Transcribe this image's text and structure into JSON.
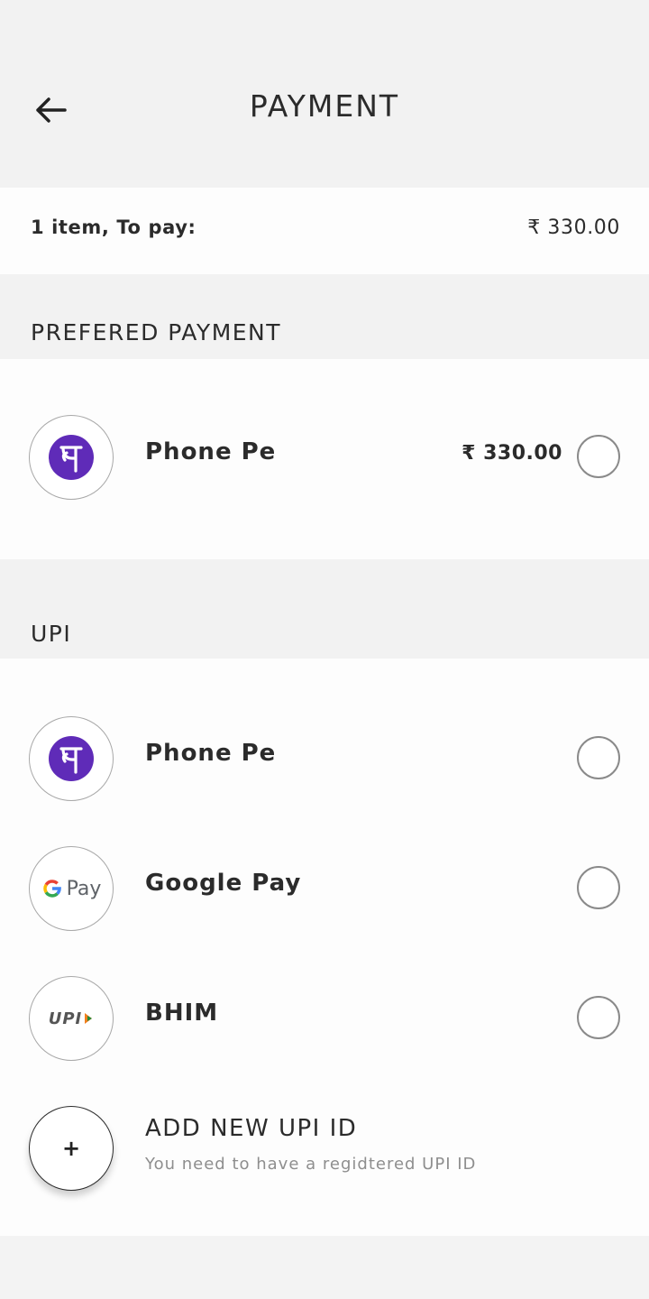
{
  "header": {
    "title": "PAYMENT",
    "back_icon": "arrow-left-icon"
  },
  "summary": {
    "label": "1 item, To pay:",
    "total": "₹ 330.00"
  },
  "preferred": {
    "title": "PREFERED PAYMENT",
    "items": [
      {
        "label": "Phone Pe",
        "amount": "₹ 330.00",
        "icon": "phonepe-logo-icon"
      }
    ]
  },
  "upi": {
    "title": "UPI",
    "items": [
      {
        "label": "Phone Pe",
        "icon": "phonepe-logo-icon"
      },
      {
        "label": "Google Pay",
        "icon": "google-pay-logo-icon",
        "logo_text": "Pay"
      },
      {
        "label": "BHIM",
        "icon": "upi-logo-icon",
        "logo_text": "UPI"
      }
    ],
    "add": {
      "symbol": "+",
      "title": "ADD NEW UPI ID",
      "subtitle": "You need to have a regidtered UPI ID"
    }
  },
  "colors": {
    "phonepe": "#5f2bb8",
    "background": "#f2f2f2",
    "panel": "#fdfdfd",
    "text": "#2b2b2b",
    "muted": "#8e8e8e"
  }
}
